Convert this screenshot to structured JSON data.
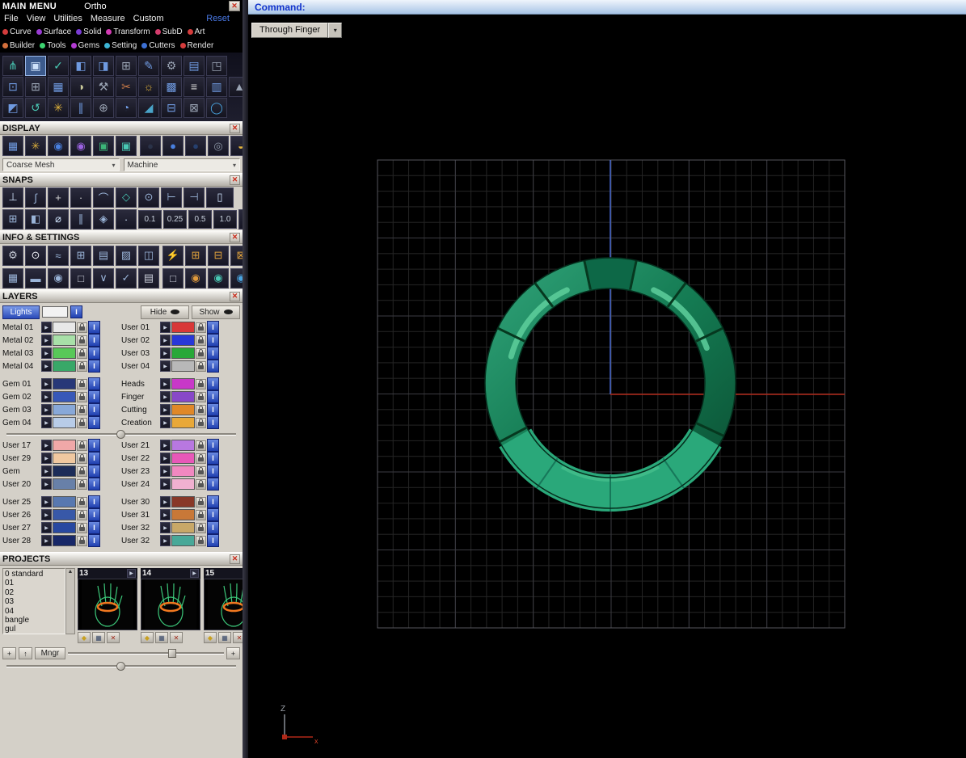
{
  "icons": {
    "close": "✕",
    "dropdown": "▾",
    "play": "▶",
    "scroll_up": "▲",
    "scroll_down": "▼"
  },
  "colors": {
    "ring_main_light": "#2ea076",
    "ring_main_mid": "#147a52",
    "ring_main_dark": "#0b5134",
    "ring_band": "#2aa87a",
    "ring_highlight": "#5ecf9c",
    "ring_tick": "#06381f",
    "axis_red": "#b02818",
    "axis_blue": "#4466cc",
    "grid_minor": "#242424",
    "grid_major": "#3b3b42",
    "grid_border": "#55555c"
  },
  "titlebar": {
    "title": "MAIN MENU",
    "mode": "Ortho"
  },
  "menubar": {
    "items": [
      "File",
      "View",
      "Utilities",
      "Measure",
      "Custom"
    ],
    "reset_label": "Reset"
  },
  "categories": {
    "row1": [
      {
        "label": "Curve",
        "dot": "#d43c3c"
      },
      {
        "label": "Surface",
        "dot": "#9a3cd4"
      },
      {
        "label": "Solid",
        "dot": "#7a3cd4"
      },
      {
        "label": "Transform",
        "dot": "#d43cb4"
      },
      {
        "label": "SubD",
        "dot": "#d43c6c"
      },
      {
        "label": "Art",
        "dot": "#d43c3c"
      }
    ],
    "row2": [
      {
        "label": "Builder",
        "dot": "#d4703c"
      },
      {
        "label": "Tools",
        "dot": "#3cd470"
      },
      {
        "label": "Gems",
        "dot": "#b43cd4"
      },
      {
        "label": "Setting",
        "dot": "#3cb4d4"
      },
      {
        "label": "Cutters",
        "dot": "#3c70d4"
      },
      {
        "label": "Render",
        "dot": "#d43c3c"
      }
    ]
  },
  "toolbar": {
    "rows": [
      [
        {
          "g": "⋔",
          "c": "#49c8b4"
        },
        {
          "g": "▣",
          "c": "#cfe2fa",
          "sel": true
        },
        {
          "g": "✓",
          "c": "#49c8b4"
        },
        {
          "g": "◧",
          "c": "#6f9ae0"
        },
        {
          "g": "◨",
          "c": "#6f9ae0"
        },
        {
          "g": "⊞",
          "c": "#9aa4b4"
        },
        {
          "g": "✎",
          "c": "#6f9ae0"
        },
        {
          "g": "⚙",
          "c": "#9aa4b4"
        },
        {
          "g": "▤",
          "c": "#6f9ae0"
        },
        {
          "g": "◳",
          "c": "#9aa4b4"
        }
      ],
      [
        {
          "g": "⊡",
          "c": "#6f9ae0"
        },
        {
          "g": "⊞",
          "c": "#9aa4b4"
        },
        {
          "g": "▦",
          "c": "#6f9ae0"
        },
        {
          "g": "◑",
          "c": "#c8c89a"
        },
        {
          "g": "⚒",
          "c": "#9aa4b4"
        },
        {
          "g": "✂",
          "c": "#c87a49"
        },
        {
          "g": "☼",
          "c": "#e0b23c"
        },
        {
          "g": "▩",
          "c": "#6f9ae0"
        },
        {
          "g": "≡",
          "c": "#d8d8d8"
        },
        {
          "g": "▥",
          "c": "#6f9ae0"
        },
        {
          "g": "▲",
          "c": "#9aa4b4"
        }
      ],
      [
        {
          "g": "◩",
          "c": "#6f9ae0"
        },
        {
          "g": "↺",
          "c": "#49c8b4"
        },
        {
          "g": "✳",
          "c": "#e0b23c"
        },
        {
          "g": "∥",
          "c": "#6f9ae0"
        },
        {
          "g": "⊕",
          "c": "#9aa4b4"
        },
        {
          "g": "◔",
          "c": "#6f9ae0"
        },
        {
          "g": "◢",
          "c": "#49a4c8"
        },
        {
          "g": "⊟",
          "c": "#6f9ae0"
        },
        {
          "g": "⊠",
          "c": "#9aa4b4"
        },
        {
          "g": "◯",
          "c": "#49a4e0"
        }
      ]
    ]
  },
  "display": {
    "header": "DISPLAY",
    "left_icons": [
      {
        "g": "▦",
        "c": "#6f9ae0"
      },
      {
        "g": "✳",
        "c": "#e0b23c"
      },
      {
        "g": "◉",
        "c": "#4980e0"
      },
      {
        "g": "◉",
        "c": "#9a62e0"
      },
      {
        "g": "▣",
        "c": "#3cb478"
      },
      {
        "g": "▣",
        "c": "#49c8b4"
      }
    ],
    "right_icons": [
      {
        "g": "●",
        "c": "#2a3248"
      },
      {
        "g": "●",
        "c": "#4980e0"
      },
      {
        "g": "●",
        "c": "#26406f"
      },
      {
        "g": "◎",
        "c": "#8a94a4"
      },
      {
        "g": "◒",
        "c": "#e0b23c"
      }
    ],
    "mesh_dropdown": "Coarse Mesh",
    "machine_dropdown": "Machine"
  },
  "snaps": {
    "header": "SNAPS",
    "row1": [
      {
        "g": "⊥",
        "c": "#cfe2fa"
      },
      {
        "g": "∫",
        "c": "#9ab4d8"
      },
      {
        "g": "+",
        "c": "#d8d8d8"
      },
      {
        "g": "·",
        "c": "#d8d8d8"
      },
      {
        "g": "⌒",
        "c": "#9ab4d8"
      },
      {
        "g": "◇",
        "c": "#49c8b4"
      },
      {
        "g": "⊙",
        "c": "#9ab4d8"
      },
      {
        "g": "⊢",
        "c": "#9ab4d8"
      },
      {
        "g": "⊣",
        "c": "#9ab4d8"
      },
      {
        "g": "▯",
        "c": "#cfe2fa",
        "w": 1
      }
    ],
    "row2_icons": [
      {
        "g": "⊞",
        "c": "#9ab4d8"
      },
      {
        "g": "◧",
        "c": "#9ab4d8"
      },
      {
        "g": "⌀",
        "c": "#cfe2fa"
      },
      {
        "g": "∥",
        "c": "#9ab4d8"
      },
      {
        "g": "◈",
        "c": "#9ab4d8"
      },
      {
        "g": "·",
        "c": "#cfe2fa"
      }
    ],
    "values": [
      "0.1",
      "0.25",
      "0.5",
      "1.0"
    ],
    "row2_end": [
      {
        "g": "⋮⋮",
        "c": "#cfe2fa"
      }
    ]
  },
  "info": {
    "header": "INFO & SETTINGS",
    "row1": [
      {
        "g": "⚙",
        "c": "#c8ccd8"
      },
      {
        "g": "⊙",
        "c": "#eef0f6"
      },
      {
        "g": "≈",
        "c": "#9ab4d8"
      },
      {
        "g": "⊞",
        "c": "#9ab4d8"
      },
      {
        "g": "▤",
        "c": "#9ab4d8"
      },
      {
        "g": "▨",
        "c": "#9ab4d8"
      },
      {
        "g": "◫",
        "c": "#9ab4d8"
      }
    ],
    "row1b": [
      {
        "g": "⚡",
        "c": "#e8b43c"
      },
      {
        "g": "⊞",
        "c": "#e0a23c"
      },
      {
        "g": "⊟",
        "c": "#e0a23c"
      },
      {
        "g": "⊠",
        "c": "#e0a23c"
      }
    ],
    "row2": [
      {
        "g": "▦",
        "c": "#9ab4d8"
      },
      {
        "g": "▬",
        "c": "#9ab4d8"
      },
      {
        "g": "◉",
        "c": "#9ab4d8"
      },
      {
        "g": "□",
        "c": "#c8ccd8"
      },
      {
        "g": "∨",
        "c": "#9ab4d8"
      },
      {
        "g": "✓",
        "c": "#9ab4d8"
      },
      {
        "g": "▤",
        "c": "#c8ccd8"
      }
    ],
    "row2b": [
      {
        "g": "□",
        "c": "#c8ccd8"
      },
      {
        "g": "◉",
        "c": "#e09a3c"
      },
      {
        "g": "◉",
        "c": "#49c8b4"
      },
      {
        "g": "◉",
        "c": "#49a4e0"
      }
    ]
  },
  "layers": {
    "header": "LAYERS",
    "lights_label": "Lights",
    "hide_label": "Hide",
    "show_label": "Show",
    "groups": [
      {
        "left": [
          {
            "name": "Metal 01",
            "color": "#e8e8e8"
          },
          {
            "name": "Metal 02",
            "color": "#a8e0a8"
          },
          {
            "name": "Metal 03",
            "color": "#58c858"
          },
          {
            "name": "Metal 04",
            "color": "#38a868"
          }
        ],
        "right": [
          {
            "name": "User 01",
            "color": "#d83838"
          },
          {
            "name": "User 02",
            "color": "#2838d8"
          },
          {
            "name": "User 03",
            "color": "#28a838"
          },
          {
            "name": "User 04",
            "color": "#b8b8b8"
          }
        ]
      },
      {
        "left": [
          {
            "name": "Gem 01",
            "color": "#283878"
          },
          {
            "name": "Gem 02",
            "color": "#3858b8"
          },
          {
            "name": "Gem 03",
            "color": "#88a8d8"
          },
          {
            "name": "Gem 04",
            "color": "#b8cce8"
          }
        ],
        "right": [
          {
            "name": "Heads",
            "color": "#c838c8"
          },
          {
            "name": "Finger",
            "color": "#8848c8"
          },
          {
            "name": "Cutting",
            "color": "#e08828"
          },
          {
            "name": "Creation",
            "color": "#e8a838"
          }
        ]
      },
      {
        "left": [
          {
            "name": "User 17",
            "color": "#f0a8a8"
          },
          {
            "name": "User 29",
            "color": "#f0c8a0"
          },
          {
            "name": "Gem",
            "color": "#1c2c58"
          },
          {
            "name": "User 20",
            "color": "#6880a8"
          }
        ],
        "right": [
          {
            "name": "User 21",
            "color": "#b878e0"
          },
          {
            "name": "User 22",
            "color": "#e858b8"
          },
          {
            "name": "User 23",
            "color": "#f088c0"
          },
          {
            "name": "User 24",
            "color": "#f0b0d0"
          }
        ]
      },
      {
        "left": [
          {
            "name": "User 25",
            "color": "#5878b0"
          },
          {
            "name": "User 26",
            "color": "#3858a8"
          },
          {
            "name": "User 27",
            "color": "#2848a0"
          },
          {
            "name": "User 28",
            "color": "#182868"
          }
        ],
        "right": [
          {
            "name": "User 30",
            "color": "#883828"
          },
          {
            "name": "User 31",
            "color": "#c87838"
          },
          {
            "name": "User 32",
            "color": "#c8a868"
          },
          {
            "name": "User 32",
            "color": "#48a898"
          }
        ]
      }
    ]
  },
  "projects": {
    "header": "PROJECTS",
    "list_items": [
      "0 standard",
      "01",
      "02",
      "03",
      "04",
      "bangle",
      "gul"
    ],
    "thumbs": [
      {
        "num": "13"
      },
      {
        "num": "14"
      },
      {
        "num": "15"
      }
    ],
    "thumb_buttons": [
      {
        "name": "gem-icon",
        "g": "◆",
        "c": "#c8a020"
      },
      {
        "name": "grid-icon",
        "g": "▦",
        "c": "#3a4a6a"
      },
      {
        "name": "delete-icon",
        "g": "✕",
        "c": "#a02818"
      }
    ],
    "plus_label": "+",
    "up_label": "↑",
    "mngr_label": "Mngr"
  },
  "viewport": {
    "command_label": "Command:",
    "tab_label": "Through Finger",
    "axis": {
      "z": "Z",
      "x": "x"
    }
  }
}
